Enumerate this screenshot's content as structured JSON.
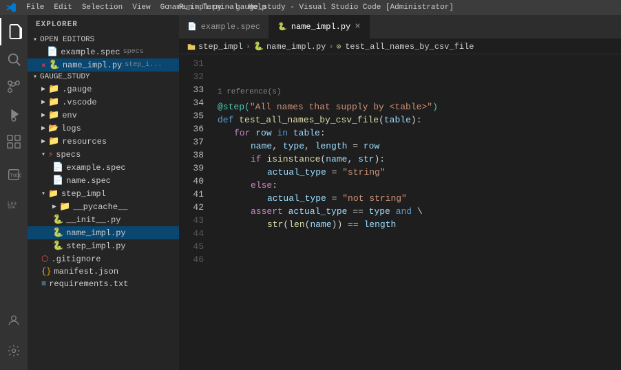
{
  "titleBar": {
    "title": "name_impl.py - gauge_study - Visual Studio Code [Administrator]",
    "menu": [
      "File",
      "Edit",
      "Selection",
      "View",
      "Go",
      "Run",
      "Terminal",
      "Help"
    ]
  },
  "sidebar": {
    "header": "EXPLORER",
    "sections": {
      "openEditors": {
        "label": "OPEN EDITORS",
        "items": [
          {
            "name": "example.spec",
            "badge": "specs",
            "icon": "file"
          },
          {
            "name": "name_impl.py",
            "badge": "step_i...",
            "icon": "py",
            "modified": true,
            "active": true
          }
        ]
      },
      "gaugeStudy": {
        "label": "GAUGE_STUDY",
        "items": [
          {
            "name": ".gauge",
            "icon": "folder",
            "indent": 1
          },
          {
            "name": ".vscode",
            "icon": "folder",
            "indent": 1
          },
          {
            "name": "env",
            "icon": "folder",
            "indent": 1
          },
          {
            "name": "logs",
            "icon": "folder",
            "indent": 1
          },
          {
            "name": "resources",
            "icon": "folder",
            "indent": 1
          },
          {
            "name": "specs",
            "icon": "gauge-folder",
            "indent": 1,
            "open": true
          },
          {
            "name": "example.spec",
            "icon": "file",
            "indent": 2
          },
          {
            "name": "name.spec",
            "icon": "file",
            "indent": 2
          },
          {
            "name": "step_impl",
            "icon": "folder",
            "indent": 1,
            "open": true
          },
          {
            "name": "__pycache__",
            "icon": "folder",
            "indent": 2
          },
          {
            "name": "__init__.py",
            "icon": "py",
            "indent": 2
          },
          {
            "name": "name_impl.py",
            "icon": "py",
            "indent": 2,
            "active": true
          },
          {
            "name": "step_impl.py",
            "icon": "py",
            "indent": 2
          },
          {
            "name": ".gitignore",
            "icon": "git",
            "indent": 1
          },
          {
            "name": "manifest.json",
            "icon": "json",
            "indent": 1
          },
          {
            "name": "requirements.txt",
            "icon": "req",
            "indent": 1
          }
        ]
      }
    }
  },
  "tabs": [
    {
      "name": "example.spec",
      "icon": "file",
      "active": false
    },
    {
      "name": "name_impl.py",
      "icon": "py",
      "active": true,
      "modified": false
    }
  ],
  "breadcrumb": {
    "items": [
      "step_impl",
      "name_impl.py",
      "test_all_names_by_csv_file"
    ]
  },
  "editor": {
    "filename": "name_impl.py",
    "referenceHint": "1 reference(s)",
    "startLine": 31,
    "lines": [
      {
        "num": "31",
        "content": ""
      },
      {
        "num": "32",
        "content": ""
      },
      {
        "num": "33",
        "tokens": [
          "decorator",
          "string"
        ]
      },
      {
        "num": "34",
        "tokens": [
          "def"
        ]
      },
      {
        "num": "35",
        "tokens": [
          "for"
        ]
      },
      {
        "num": "36",
        "tokens": [
          "assign"
        ]
      },
      {
        "num": "37",
        "tokens": [
          "if"
        ]
      },
      {
        "num": "38",
        "tokens": [
          "actual_type_str"
        ]
      },
      {
        "num": "39",
        "tokens": [
          "else"
        ]
      },
      {
        "num": "40",
        "tokens": [
          "actual_type_not"
        ]
      },
      {
        "num": "41",
        "tokens": [
          "assert"
        ]
      },
      {
        "num": "42",
        "tokens": [
          "str_len"
        ]
      },
      {
        "num": "43",
        "content": ""
      },
      {
        "num": "44",
        "content": ""
      },
      {
        "num": "45",
        "content": ""
      },
      {
        "num": "46",
        "content": ""
      }
    ]
  },
  "activityBar": {
    "items": [
      "explorer",
      "search",
      "source-control",
      "run-debug",
      "extensions",
      "todo",
      "lua-ide"
    ],
    "bottom": [
      "accounts",
      "settings"
    ]
  },
  "colors": {
    "accent": "#0078d4",
    "activeTabBorder": "#0078d4",
    "background": "#1e1e1e",
    "sidebar": "#252526",
    "activityBar": "#333333"
  }
}
